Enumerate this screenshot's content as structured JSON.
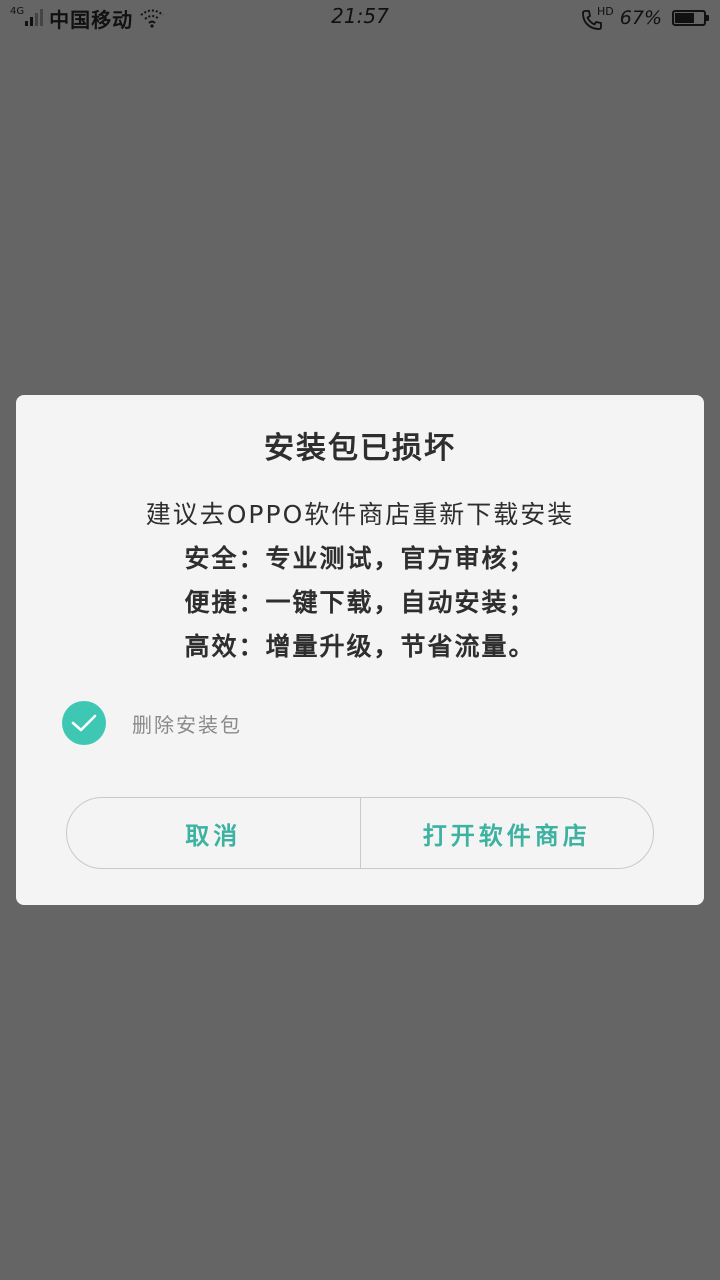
{
  "status_bar": {
    "network_type": "4G",
    "carrier": "中国移动",
    "time": "21:57",
    "hd_label": "HD",
    "battery_percent_text": "67%",
    "battery_level": 0.67
  },
  "dialog": {
    "title": "安装包已损坏",
    "message_lines": [
      "建议去OPPO软件商店重新下载安装",
      "安全：专业测试，官方审核；",
      "便捷：一键下载，自动安装；",
      "高效：增量升级，节省流量。"
    ],
    "checkbox": {
      "label": "删除安装包",
      "checked": true
    },
    "buttons": {
      "cancel": "取消",
      "open_store": "打开软件商店"
    }
  },
  "colors": {
    "overlay": "#656565",
    "dialog_bg": "#f4f4f4",
    "accent": "#3ec8b3",
    "button_text": "#3db2a1"
  },
  "icons": {
    "signal": "signal-strength-icon",
    "wifi": "wifi-icon",
    "call": "hd-call-icon",
    "battery": "battery-icon",
    "check": "check-icon"
  }
}
